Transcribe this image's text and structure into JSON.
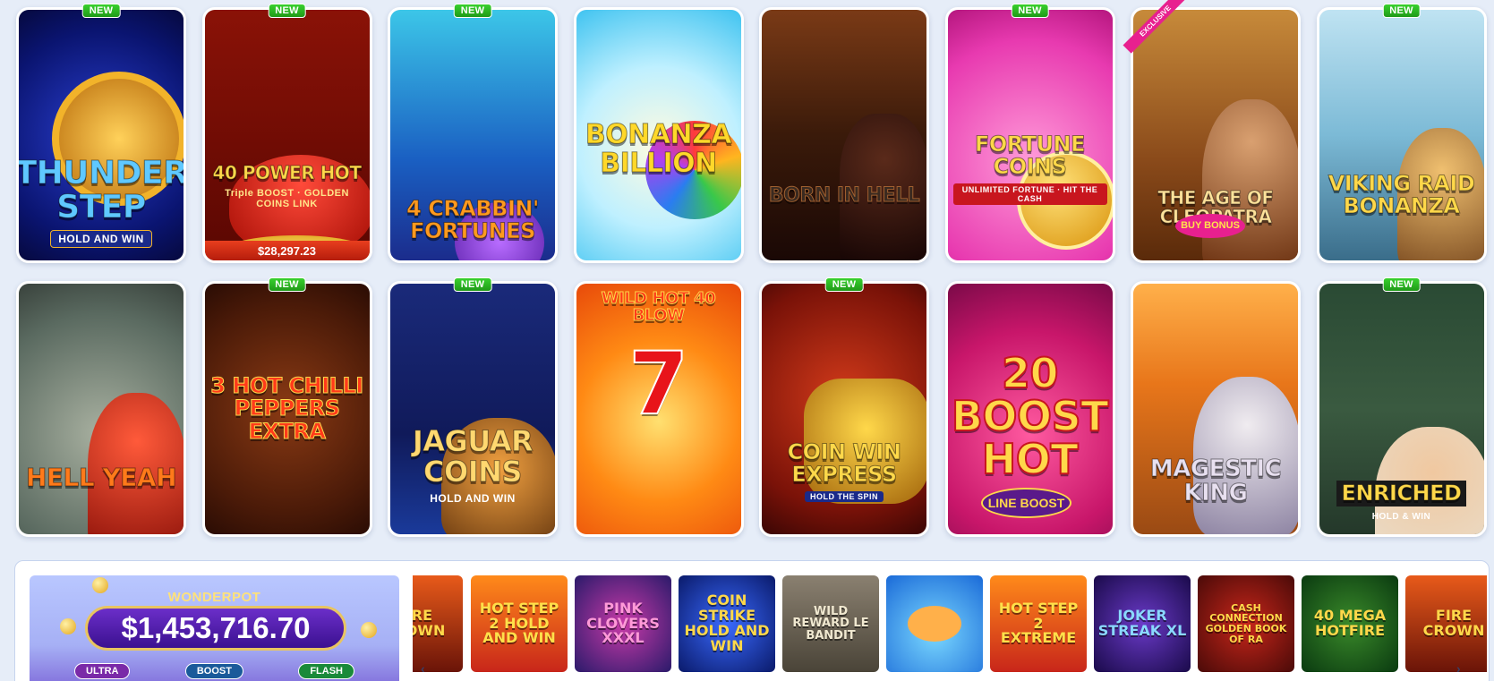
{
  "badge_new": "NEW",
  "row1": [
    {
      "id": "thunder-step",
      "title": "THUNDER STEP",
      "sub": "HOLD AND WIN",
      "new": true
    },
    {
      "id": "power-hot",
      "title": "40 POWER HOT",
      "sub": "Triple BOOST · GOLDEN COINS LINK",
      "new": true,
      "jackpot": "$28,297.23"
    },
    {
      "id": "crabbin",
      "title": "4 CRABBIN' FORTUNES",
      "sub": "",
      "new": true
    },
    {
      "id": "bonanza-billion",
      "title": "BONANZA BILLION",
      "sub": "",
      "new": false
    },
    {
      "id": "born-in-hell",
      "title": "BORN IN HELL",
      "sub": "",
      "new": false
    },
    {
      "id": "fortune-coins",
      "title": "FORTUNE COINS",
      "sub": "UNLIMITED FORTUNE · HIT THE CASH",
      "new": true
    },
    {
      "id": "cleopatra",
      "title": "THE AGE OF CLEOPATRA",
      "sub": "",
      "new": false,
      "exclusive": "EXCLUSIVE",
      "tag": "BUY BONUS"
    },
    {
      "id": "viking-raid",
      "title": "VIKING RAID BONANZA",
      "sub": "",
      "new": true
    }
  ],
  "row2": [
    {
      "id": "hell-yeah",
      "title": "HELL YEAH",
      "sub": "",
      "new": false
    },
    {
      "id": "hot-chilli",
      "title": "3 HOT CHILLI PEPPERS EXTRA",
      "sub": "",
      "new": true
    },
    {
      "id": "jaguar-coins",
      "title": "JAGUAR COINS",
      "sub": "HOLD AND WIN",
      "new": true
    },
    {
      "id": "wild-hot",
      "title": "WILD HOT 40 BLOW",
      "sub": "7",
      "new": false
    },
    {
      "id": "coin-win",
      "title": "COIN WIN EXPRESS",
      "sub": "HOLD THE SPIN",
      "new": true
    },
    {
      "id": "boost-hot",
      "title": "20 BOOST HOT",
      "sub": "",
      "new": false,
      "tag": "LINE BOOST"
    },
    {
      "id": "magestic-king",
      "title": "MAGESTIC KING",
      "sub": "",
      "new": false
    },
    {
      "id": "enriched",
      "title": "ENRICHED",
      "sub": "HOLD & WIN",
      "new": true
    }
  ],
  "wonderpot": {
    "title": "WONDERPOT",
    "amount": "$1,453,716.70",
    "tags": [
      "ULTRA",
      "BOOST",
      "FLASH"
    ]
  },
  "strip": [
    {
      "id": "fire-crown-a",
      "label": "FIRE CROWN"
    },
    {
      "id": "hot-step-2",
      "label": "HOT STEP 2 HOLD AND WIN"
    },
    {
      "id": "pink-clovers",
      "label": "PINK CLOVERS XXXL"
    },
    {
      "id": "coin-strike",
      "label": "COIN STRIKE HOLD AND WIN"
    },
    {
      "id": "le-bandit",
      "label": "WILD REWARD LE BANDIT"
    },
    {
      "id": "shark",
      "label": ""
    },
    {
      "id": "hot-step-2-extreme",
      "label": "HOT STEP 2 EXTREME"
    },
    {
      "id": "joker-streak",
      "label": "JOKER STREAK XL"
    },
    {
      "id": "cash-connection",
      "label": "CASH CONNECTION GOLDEN BOOK OF RA"
    },
    {
      "id": "mega-hotfire",
      "label": "40 MEGA HOTFIRE"
    },
    {
      "id": "fire-crown-b",
      "label": "FIRE CROWN"
    }
  ],
  "colors": {
    "page_bg": "#e6edf8",
    "new_badge": "#2bb521",
    "jackpot_bar": "#d62f16",
    "wonderpot_amount_bg": "#4a1aa8"
  }
}
